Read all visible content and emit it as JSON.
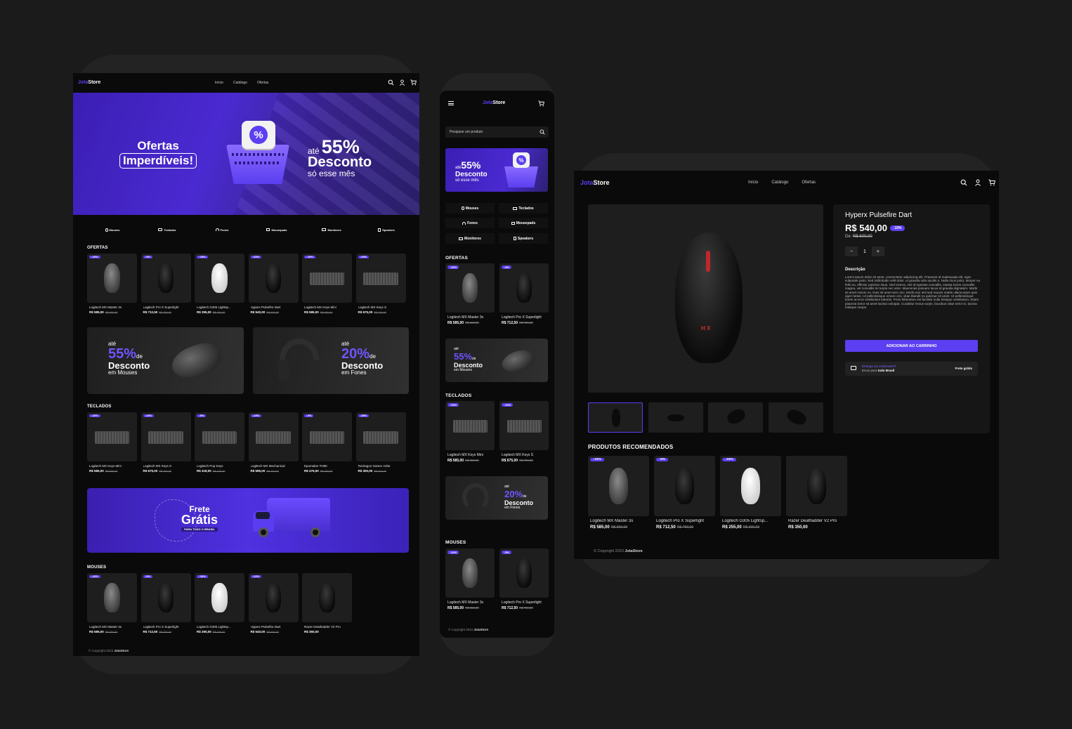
{
  "brand": {
    "part1": "Jota",
    "part2": "Store"
  },
  "nav": {
    "inicio": "Início",
    "catalogo": "Catálogo",
    "ofertas": "Ofertas"
  },
  "hero": {
    "line1": "Ofertas",
    "line2": "Imperdíveis!",
    "ate": "até",
    "percent": "55%",
    "desconto": "Desconto",
    "sub": "só esse mês",
    "badge_symbol": "%"
  },
  "categories": [
    "Mouses",
    "Teclados",
    "Fones",
    "Mousepads",
    "Monitores",
    "Speakers"
  ],
  "sections": {
    "ofertas": "OFERTAS",
    "teclados": "TECLADOS",
    "mouses": "MOUSES",
    "recomendados": "PRODUTOS RECOMENDADOS"
  },
  "ofertas": [
    {
      "badge": "↓10%",
      "name": "Logitech MX Master 3s",
      "price": "R$ 585,00",
      "old": "R$ 650,00"
    },
    {
      "badge": "↓5%",
      "name": "Logitech Pro X Superlight",
      "price": "R$ 712,50",
      "old": "R$ 750,00"
    },
    {
      "badge": "↓15%",
      "name": "Logitech G305 Lightsp...",
      "price": "R$ 255,00",
      "old": "R$ 300,00"
    },
    {
      "badge": "↓10%",
      "name": "Hyperx Pulsefire Dart",
      "price": "R$ 540,00",
      "old": "R$ 600,00"
    },
    {
      "badge": "↓10%",
      "name": "Logitech MX Keys Mini",
      "price": "R$ 585,00",
      "old": "R$ 650,00"
    },
    {
      "badge": "↓10%",
      "name": "Logitech MX Keys S",
      "price": "R$ 675,00",
      "old": "R$ 750,00"
    }
  ],
  "promos": {
    "p1": {
      "ate": "até",
      "percent": "55%",
      "de": "de",
      "desconto": "Desconto",
      "sub": "em Mouses"
    },
    "p2": {
      "ate": "até",
      "percent": "20%",
      "de": "de",
      "desconto": "Desconto",
      "sub": "em Fones"
    }
  },
  "teclados": [
    {
      "badge": "↓10%",
      "name": "Logitech MX Keys Mini",
      "price": "R$ 585,00",
      "old": "R$ 650,00"
    },
    {
      "badge": "↓10%",
      "name": "Logitech MX Keys S",
      "price": "R$ 675,00",
      "old": "R$ 750,00"
    },
    {
      "badge": "↓5%",
      "name": "Logitech Pop Keys",
      "price": "R$ 418,00",
      "old": "R$ 440,00"
    },
    {
      "badge": "↓15%",
      "name": "Logitech MX Mechanical",
      "price": "R$ 595,00",
      "old": "R$ 700,00"
    },
    {
      "badge": "↓5%",
      "name": "Epomaker TH80",
      "price": "R$ 475,00",
      "old": "R$ 500,00"
    },
    {
      "badge": "↓25%",
      "name": "Redragon Gamer Ashe",
      "price": "R$ 300,00",
      "old": "R$ 400,00"
    }
  ],
  "frete": {
    "line1": "Frete",
    "line2": "Grátis",
    "sub": "PARA TODO O BRASIL"
  },
  "mouses": [
    {
      "badge": "↓10%",
      "name": "Logitech MX Master 3s",
      "price": "R$ 585,00",
      "old": "R$ 650,00"
    },
    {
      "badge": "↓5%",
      "name": "Logitech Pro X Superlight",
      "price": "R$ 712,50",
      "old": "R$ 750,00"
    },
    {
      "badge": "↓15%",
      "name": "Logitech G305 Lightsp...",
      "price": "R$ 255,00",
      "old": "R$ 300,00"
    },
    {
      "badge": "↓10%",
      "name": "Hyperx Pulsefire Dart",
      "price": "R$ 540,00",
      "old": "R$ 600,00"
    },
    {
      "badge": "",
      "name": "Razer Deathadder V2 Pro",
      "price": "R$ 350,00",
      "old": ""
    }
  ],
  "footer": {
    "text": "© Copyright 2023",
    "brand": "JotaStore"
  },
  "mobile": {
    "search_placeholder": "Pesquise um produto"
  },
  "product": {
    "title": "Hyperx Pulsefire Dart",
    "price": "R$ 540,00",
    "badge": "↓10%",
    "de_label": "De:",
    "old": "R$ 600,00",
    "qty": "1",
    "minus": "−",
    "plus": "+",
    "desc_title": "Descrição",
    "desc": "Lorem ipsum dolor sit amet, consectetur adipiscing elit. Praesent id malesuada elit, eget vulputate justo. Sed sollicitudin velit dolor, ut gravida odio iaculis a. Nulla risus justo, tempor eu felis eu, efficitur pulvinar risus. Sed viverra, nisi id egestas convallis, massa lorem convallis magna, vel convallis mi turpis nec ante. Maecenas posuere lacus id gravida dignissim. Morbi sit amet rutrum ex. Duis sit amet sem orci. Morbi non nisl sed mauris mattis ullamcorper quis eget metus. Ut pellentesque ornare orci, vitae blandit ex pulvinar sit amet. Ut pellentesque lorem at eros vestibulum lobortis. Proin bibendum est facilisis nulla tristique vestibulum. Etiam placerat tortor sit amet lacinia volutpat. Curabitur lectus turpis, faucibus vitae tortor in, lacinia tristique neque.",
    "cta": "ADICIONAR AO CARRINHO",
    "ship_line1": "Entrega via JotaFaster®",
    "ship_line2a": "Envio para ",
    "ship_line2b": "todo Brasil",
    "ship_right": "Frete grátis"
  },
  "recomendados": [
    {
      "badge": "↓10%",
      "name": "Logitech MX Master 3s",
      "price": "R$ 585,00",
      "old": "R$ 650,00"
    },
    {
      "badge": "↓5%",
      "name": "Logitech Pro X Superlight",
      "price": "R$ 712,50",
      "old": "R$ 750,00"
    },
    {
      "badge": "↓15%",
      "name": "Logitech G305 Lightsp...",
      "price": "R$ 255,00",
      "old": "R$ 300,00"
    },
    {
      "badge": "",
      "name": "Razer Deathadder V2 Pro",
      "price": "R$ 350,00",
      "old": ""
    }
  ],
  "colors": {
    "accent": "#5b3ff0",
    "bg": "#0a0a0a",
    "card": "#1e1e1e",
    "page": "#1b1b1b"
  }
}
